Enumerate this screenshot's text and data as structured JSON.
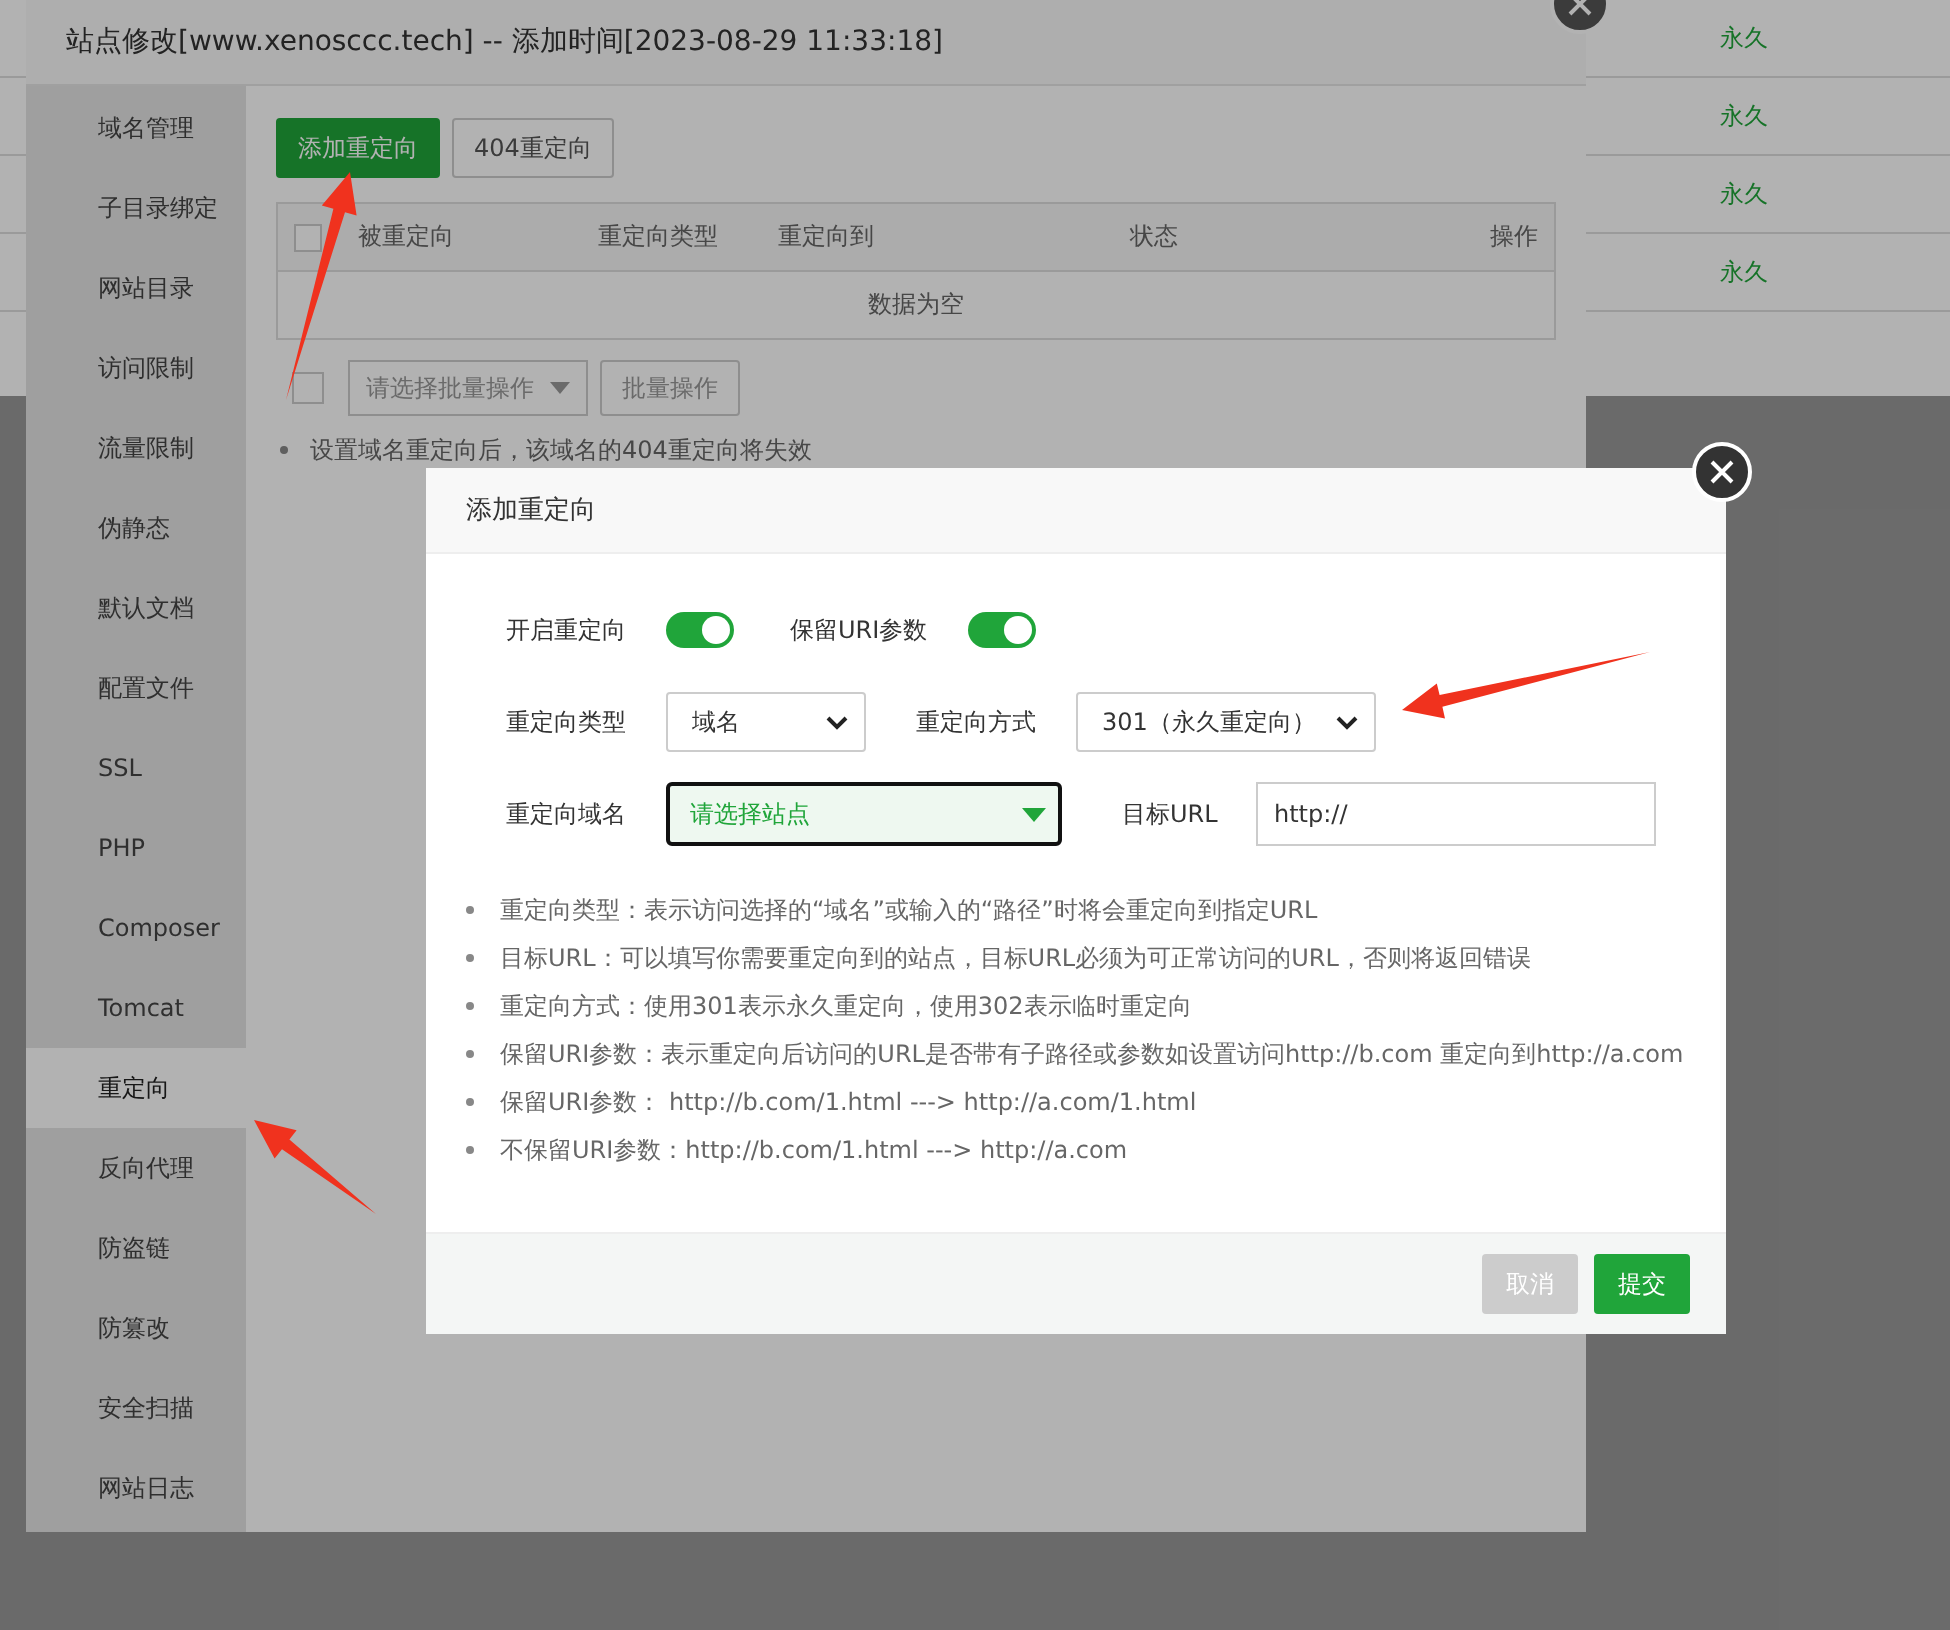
{
  "background_table": {
    "rows": [
      {
        "cell": "永久"
      },
      {
        "cell": "永久"
      },
      {
        "cell": "永久"
      },
      {
        "cell": "永久"
      }
    ]
  },
  "site_dialog": {
    "title": "站点修改[www.xenosccc.tech] -- 添加时间[2023-08-29 11:33:18]",
    "sidebar": {
      "items": [
        {
          "label": "域名管理",
          "selected": false
        },
        {
          "label": "子目录绑定",
          "selected": false
        },
        {
          "label": "网站目录",
          "selected": false
        },
        {
          "label": "访问限制",
          "selected": false
        },
        {
          "label": "流量限制",
          "selected": false
        },
        {
          "label": "伪静态",
          "selected": false
        },
        {
          "label": "默认文档",
          "selected": false
        },
        {
          "label": "配置文件",
          "selected": false
        },
        {
          "label": "SSL",
          "selected": false
        },
        {
          "label": "PHP",
          "selected": false
        },
        {
          "label": "Composer",
          "selected": false
        },
        {
          "label": "Tomcat",
          "selected": false
        },
        {
          "label": "重定向",
          "selected": true
        },
        {
          "label": "反向代理",
          "selected": false
        },
        {
          "label": "防盗链",
          "selected": false
        },
        {
          "label": "防篡改",
          "selected": false
        },
        {
          "label": "安全扫描",
          "selected": false
        },
        {
          "label": "网站日志",
          "selected": false
        }
      ]
    },
    "buttons": [
      {
        "label": "添加重定向",
        "kind": "primary"
      },
      {
        "label": "404重定向",
        "kind": "default"
      }
    ],
    "table": {
      "select_all_checked": false,
      "columns": [
        "被重定向",
        "重定向类型",
        "重定向到",
        "状态",
        "操作"
      ],
      "empty_text": "数据为空"
    },
    "batch": {
      "checked": false,
      "placeholder": "请选择批量操作",
      "button": "批量操作"
    },
    "notes": [
      "设置域名重定向后，该域名的404重定向将失效"
    ]
  },
  "redirect_dialog": {
    "title": "添加重定向",
    "toggles": [
      {
        "label": "开启重定向",
        "on": true
      },
      {
        "label": "保留URI参数",
        "on": true
      }
    ],
    "field_rows": [
      [
        {
          "label": "重定向类型",
          "kind": "select",
          "value": "域名"
        },
        {
          "label": "重定向方式",
          "kind": "select",
          "value": "301（永久重定向）"
        }
      ],
      [
        {
          "label": "重定向域名",
          "kind": "site-select",
          "placeholder": "请选择站点"
        },
        {
          "label": "目标URL",
          "kind": "input",
          "value": "http://"
        }
      ]
    ],
    "notes": [
      "重定向类型：表示访问选择的“域名”或输入的“路径”时将会重定向到指定URL",
      "目标URL：可以填写你需要重定向到的站点，目标URL必须为可正常访问的URL，否则将返回错误",
      "重定向方式：使用301表示永久重定向，使用302表示临时重定向",
      "保留URI参数：表示重定向后访问的URL是否带有子路径或参数如设置访问http://b.com 重定向到http://a.com",
      "保留URI参数： http://b.com/1.html ---> http://a.com/1.html",
      "不保留URI参数：http://b.com/1.html ---> http://a.com"
    ],
    "buttons": [
      {
        "label": "取消",
        "kind": "cancel"
      },
      {
        "label": "提交",
        "kind": "submit"
      }
    ]
  }
}
